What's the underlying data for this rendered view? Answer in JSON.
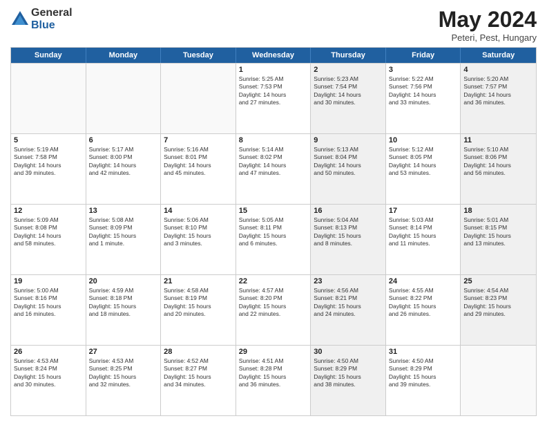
{
  "logo": {
    "general": "General",
    "blue": "Blue"
  },
  "title": "May 2024",
  "subtitle": "Peteri, Pest, Hungary",
  "days": [
    "Sunday",
    "Monday",
    "Tuesday",
    "Wednesday",
    "Thursday",
    "Friday",
    "Saturday"
  ],
  "rows": [
    [
      {
        "day": "",
        "lines": [],
        "shaded": false,
        "empty": true
      },
      {
        "day": "",
        "lines": [],
        "shaded": false,
        "empty": true
      },
      {
        "day": "",
        "lines": [],
        "shaded": false,
        "empty": true
      },
      {
        "day": "1",
        "lines": [
          "Sunrise: 5:25 AM",
          "Sunset: 7:53 PM",
          "Daylight: 14 hours",
          "and 27 minutes."
        ],
        "shaded": false,
        "empty": false
      },
      {
        "day": "2",
        "lines": [
          "Sunrise: 5:23 AM",
          "Sunset: 7:54 PM",
          "Daylight: 14 hours",
          "and 30 minutes."
        ],
        "shaded": true,
        "empty": false
      },
      {
        "day": "3",
        "lines": [
          "Sunrise: 5:22 AM",
          "Sunset: 7:56 PM",
          "Daylight: 14 hours",
          "and 33 minutes."
        ],
        "shaded": false,
        "empty": false
      },
      {
        "day": "4",
        "lines": [
          "Sunrise: 5:20 AM",
          "Sunset: 7:57 PM",
          "Daylight: 14 hours",
          "and 36 minutes."
        ],
        "shaded": true,
        "empty": false
      }
    ],
    [
      {
        "day": "5",
        "lines": [
          "Sunrise: 5:19 AM",
          "Sunset: 7:58 PM",
          "Daylight: 14 hours",
          "and 39 minutes."
        ],
        "shaded": false,
        "empty": false
      },
      {
        "day": "6",
        "lines": [
          "Sunrise: 5:17 AM",
          "Sunset: 8:00 PM",
          "Daylight: 14 hours",
          "and 42 minutes."
        ],
        "shaded": false,
        "empty": false
      },
      {
        "day": "7",
        "lines": [
          "Sunrise: 5:16 AM",
          "Sunset: 8:01 PM",
          "Daylight: 14 hours",
          "and 45 minutes."
        ],
        "shaded": false,
        "empty": false
      },
      {
        "day": "8",
        "lines": [
          "Sunrise: 5:14 AM",
          "Sunset: 8:02 PM",
          "Daylight: 14 hours",
          "and 47 minutes."
        ],
        "shaded": false,
        "empty": false
      },
      {
        "day": "9",
        "lines": [
          "Sunrise: 5:13 AM",
          "Sunset: 8:04 PM",
          "Daylight: 14 hours",
          "and 50 minutes."
        ],
        "shaded": true,
        "empty": false
      },
      {
        "day": "10",
        "lines": [
          "Sunrise: 5:12 AM",
          "Sunset: 8:05 PM",
          "Daylight: 14 hours",
          "and 53 minutes."
        ],
        "shaded": false,
        "empty": false
      },
      {
        "day": "11",
        "lines": [
          "Sunrise: 5:10 AM",
          "Sunset: 8:06 PM",
          "Daylight: 14 hours",
          "and 56 minutes."
        ],
        "shaded": true,
        "empty": false
      }
    ],
    [
      {
        "day": "12",
        "lines": [
          "Sunrise: 5:09 AM",
          "Sunset: 8:08 PM",
          "Daylight: 14 hours",
          "and 58 minutes."
        ],
        "shaded": false,
        "empty": false
      },
      {
        "day": "13",
        "lines": [
          "Sunrise: 5:08 AM",
          "Sunset: 8:09 PM",
          "Daylight: 15 hours",
          "and 1 minute."
        ],
        "shaded": false,
        "empty": false
      },
      {
        "day": "14",
        "lines": [
          "Sunrise: 5:06 AM",
          "Sunset: 8:10 PM",
          "Daylight: 15 hours",
          "and 3 minutes."
        ],
        "shaded": false,
        "empty": false
      },
      {
        "day": "15",
        "lines": [
          "Sunrise: 5:05 AM",
          "Sunset: 8:11 PM",
          "Daylight: 15 hours",
          "and 6 minutes."
        ],
        "shaded": false,
        "empty": false
      },
      {
        "day": "16",
        "lines": [
          "Sunrise: 5:04 AM",
          "Sunset: 8:13 PM",
          "Daylight: 15 hours",
          "and 8 minutes."
        ],
        "shaded": true,
        "empty": false
      },
      {
        "day": "17",
        "lines": [
          "Sunrise: 5:03 AM",
          "Sunset: 8:14 PM",
          "Daylight: 15 hours",
          "and 11 minutes."
        ],
        "shaded": false,
        "empty": false
      },
      {
        "day": "18",
        "lines": [
          "Sunrise: 5:01 AM",
          "Sunset: 8:15 PM",
          "Daylight: 15 hours",
          "and 13 minutes."
        ],
        "shaded": true,
        "empty": false
      }
    ],
    [
      {
        "day": "19",
        "lines": [
          "Sunrise: 5:00 AM",
          "Sunset: 8:16 PM",
          "Daylight: 15 hours",
          "and 16 minutes."
        ],
        "shaded": false,
        "empty": false
      },
      {
        "day": "20",
        "lines": [
          "Sunrise: 4:59 AM",
          "Sunset: 8:18 PM",
          "Daylight: 15 hours",
          "and 18 minutes."
        ],
        "shaded": false,
        "empty": false
      },
      {
        "day": "21",
        "lines": [
          "Sunrise: 4:58 AM",
          "Sunset: 8:19 PM",
          "Daylight: 15 hours",
          "and 20 minutes."
        ],
        "shaded": false,
        "empty": false
      },
      {
        "day": "22",
        "lines": [
          "Sunrise: 4:57 AM",
          "Sunset: 8:20 PM",
          "Daylight: 15 hours",
          "and 22 minutes."
        ],
        "shaded": false,
        "empty": false
      },
      {
        "day": "23",
        "lines": [
          "Sunrise: 4:56 AM",
          "Sunset: 8:21 PM",
          "Daylight: 15 hours",
          "and 24 minutes."
        ],
        "shaded": true,
        "empty": false
      },
      {
        "day": "24",
        "lines": [
          "Sunrise: 4:55 AM",
          "Sunset: 8:22 PM",
          "Daylight: 15 hours",
          "and 26 minutes."
        ],
        "shaded": false,
        "empty": false
      },
      {
        "day": "25",
        "lines": [
          "Sunrise: 4:54 AM",
          "Sunset: 8:23 PM",
          "Daylight: 15 hours",
          "and 29 minutes."
        ],
        "shaded": true,
        "empty": false
      }
    ],
    [
      {
        "day": "26",
        "lines": [
          "Sunrise: 4:53 AM",
          "Sunset: 8:24 PM",
          "Daylight: 15 hours",
          "and 30 minutes."
        ],
        "shaded": false,
        "empty": false
      },
      {
        "day": "27",
        "lines": [
          "Sunrise: 4:53 AM",
          "Sunset: 8:25 PM",
          "Daylight: 15 hours",
          "and 32 minutes."
        ],
        "shaded": false,
        "empty": false
      },
      {
        "day": "28",
        "lines": [
          "Sunrise: 4:52 AM",
          "Sunset: 8:27 PM",
          "Daylight: 15 hours",
          "and 34 minutes."
        ],
        "shaded": false,
        "empty": false
      },
      {
        "day": "29",
        "lines": [
          "Sunrise: 4:51 AM",
          "Sunset: 8:28 PM",
          "Daylight: 15 hours",
          "and 36 minutes."
        ],
        "shaded": false,
        "empty": false
      },
      {
        "day": "30",
        "lines": [
          "Sunrise: 4:50 AM",
          "Sunset: 8:29 PM",
          "Daylight: 15 hours",
          "and 38 minutes."
        ],
        "shaded": true,
        "empty": false
      },
      {
        "day": "31",
        "lines": [
          "Sunrise: 4:50 AM",
          "Sunset: 8:29 PM",
          "Daylight: 15 hours",
          "and 39 minutes."
        ],
        "shaded": false,
        "empty": false
      },
      {
        "day": "",
        "lines": [],
        "shaded": true,
        "empty": true
      }
    ]
  ]
}
